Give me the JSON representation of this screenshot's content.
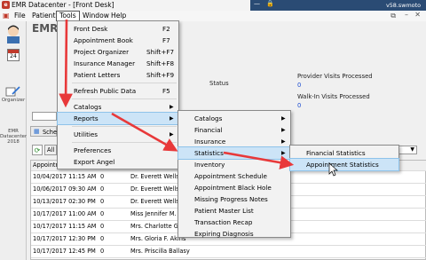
{
  "window": {
    "title": "EMR Datacenter - [Front Desk]",
    "version": "v58.swmoto"
  },
  "menubar": [
    {
      "label": "File"
    },
    {
      "label": "Patient"
    },
    {
      "label": "Tools"
    },
    {
      "label": "Window"
    },
    {
      "label": "Help"
    }
  ],
  "sidebar": {
    "organizer_label": "Organizer",
    "date_top": "24",
    "app_lines": [
      "EMR",
      "Datacenter",
      "2018"
    ]
  },
  "header": {
    "app_title": "EMR",
    "status_label": "Status",
    "provider_visits_label": "Provider Visits Processed",
    "provider_visits_value": "0",
    "walkin_visits_label": "Walk-In Visits Processed",
    "walkin_visits_value": "0",
    "partial_sche": "Sche",
    "partial_all": "All",
    "appointment_header": "Appointm"
  },
  "appointments": [
    {
      "time": "10/04/2017 11:15 AM",
      "n": "0",
      "provider": "Dr. Everett Wells J"
    },
    {
      "time": "10/06/2017 09:30 AM",
      "n": "0",
      "provider": "Dr. Everett Wells J"
    },
    {
      "time": "10/13/2017 02:30 PM",
      "n": "0",
      "provider": "Dr. Everett Wells J"
    },
    {
      "time": "10/17/2017 11:00 AM",
      "n": "0",
      "provider": "Miss Jennifer M. S"
    },
    {
      "time": "10/17/2017 11:15 AM",
      "n": "0",
      "provider": "Mrs. Charlotte G. A"
    },
    {
      "time": "10/17/2017 12:30 PM",
      "n": "0",
      "provider": "Mrs. Gloria F. Akins"
    },
    {
      "time": "10/17/2017 12:45 PM",
      "n": "0",
      "provider": "Mrs. Priscilla Ballasy"
    }
  ],
  "tools_menu": {
    "items": [
      {
        "label": "Front Desk",
        "shortcut": "F2"
      },
      {
        "label": "Appointment Book",
        "shortcut": "F7"
      },
      {
        "label": "Project Organizer",
        "shortcut": "Shift+F7"
      },
      {
        "label": "Insurance Manager",
        "shortcut": "Shift+F8"
      },
      {
        "label": "Patient Letters",
        "shortcut": "Shift+F9"
      },
      {
        "label": "Refresh Public Data",
        "shortcut": "F5"
      },
      {
        "label": "Catalogs"
      },
      {
        "label": "Reports"
      },
      {
        "label": "Utilities"
      },
      {
        "label": "Preferences"
      },
      {
        "label": "Export Angel"
      }
    ]
  },
  "reports_menu": {
    "items": [
      {
        "label": "Catalogs"
      },
      {
        "label": "Financial"
      },
      {
        "label": "Insurance"
      },
      {
        "label": "Statistics"
      },
      {
        "label": "Inventory"
      },
      {
        "label": "Appointment Schedule"
      },
      {
        "label": "Appointment Black Hole"
      },
      {
        "label": "Missing Progress Notes"
      },
      {
        "label": "Patient Master List"
      },
      {
        "label": "Transaction Recap"
      },
      {
        "label": "Expiring Diagnosis"
      }
    ]
  },
  "statistics_menu": {
    "items": [
      {
        "label": "Financial Statistics"
      },
      {
        "label": "Appointment Statistics"
      }
    ]
  },
  "colors": {
    "arrow": "#e8393a",
    "highlight": "#cce4f7",
    "titlebar_right": "#2a4b74",
    "link_blue": "#1f4fd1"
  }
}
